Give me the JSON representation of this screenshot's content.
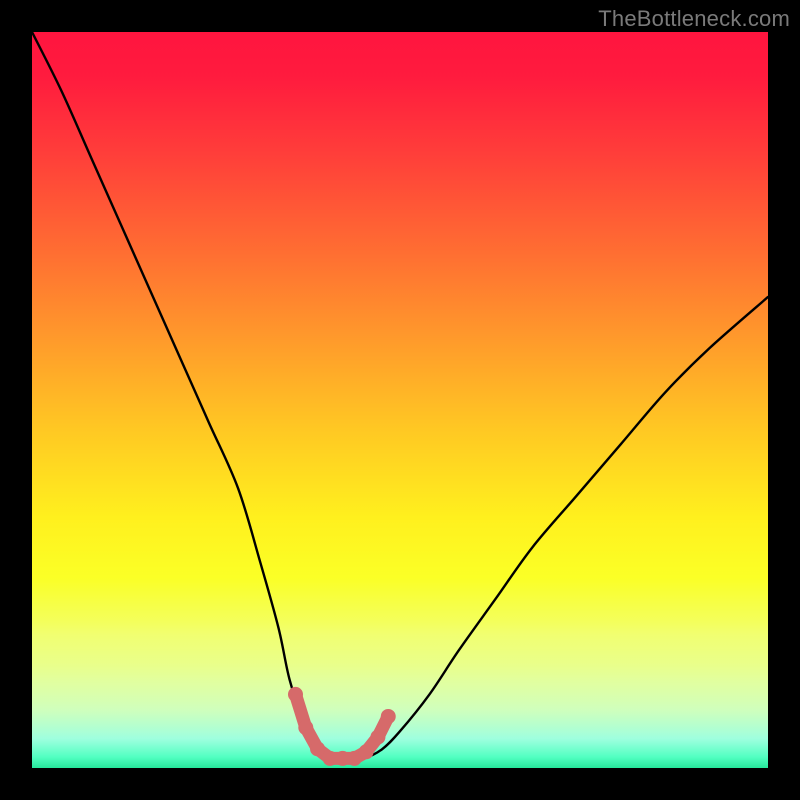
{
  "watermark": {
    "text": "TheBottleneck.com"
  },
  "colors": {
    "frame": "#000000",
    "curve": "#000000",
    "markers": "#d66a6a",
    "gradient_top": "#ff153f",
    "gradient_bottom": "#26e79b"
  },
  "chart_data": {
    "type": "line",
    "title": "",
    "xlabel": "",
    "ylabel": "",
    "xlim": [
      0,
      100
    ],
    "ylim": [
      0,
      100
    ],
    "grid": false,
    "legend": false,
    "series": [
      {
        "name": "bottleneck-curve",
        "x": [
          0,
          4,
          8,
          12,
          16,
          20,
          24,
          28,
          31,
          33.5,
          35,
          37,
          39,
          41,
          43,
          45,
          47.5,
          50,
          54,
          58,
          63,
          68,
          74,
          80,
          86,
          92,
          100
        ],
        "y": [
          100,
          92,
          83,
          74,
          65,
          56,
          47,
          38,
          28,
          19,
          12,
          6,
          2.5,
          1.3,
          1.3,
          1.3,
          2.5,
          5,
          10,
          16,
          23,
          30,
          37,
          44,
          51,
          57,
          64
        ]
      }
    ],
    "markers": {
      "name": "valley-points",
      "x": [
        35.8,
        37.2,
        38.8,
        40.5,
        42.2,
        43.8,
        45.4,
        47.0,
        48.4
      ],
      "y": [
        10.0,
        5.5,
        2.6,
        1.3,
        1.3,
        1.3,
        2.2,
        4.2,
        7.0
      ]
    }
  }
}
